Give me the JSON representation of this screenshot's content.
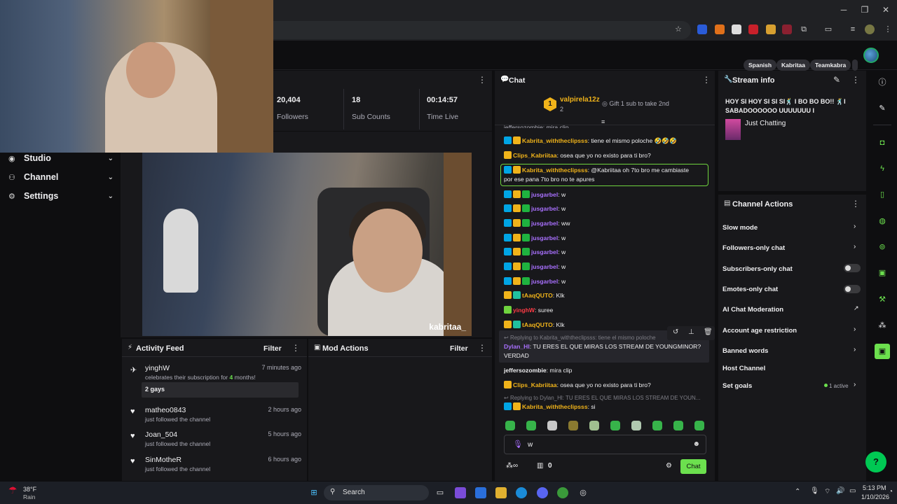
{
  "browser": {
    "win_minimize": "─",
    "win_maximize": "❐",
    "win_close": "✕",
    "icons": [
      "star-icon",
      "extension-icon",
      "extension-icon",
      "extension-icon",
      "extension-icon",
      "extension-icon",
      "extension-icon",
      "puzzle-icon",
      "sidebar-icon",
      "media-icon",
      "profile-icon",
      "menu-icon"
    ]
  },
  "sidebar": {
    "items": [
      {
        "label": "Studio",
        "icon": "studio-icon"
      },
      {
        "label": "Channel",
        "icon": "channel-icon"
      },
      {
        "label": "Settings",
        "icon": "gear-icon"
      }
    ]
  },
  "stats": [
    {
      "value": "20,404",
      "label": "Followers"
    },
    {
      "value": "18",
      "label": "Sub Counts"
    },
    {
      "value": "00:14:57",
      "label": "Time Live"
    }
  ],
  "video": {
    "watermark": "kabritaa_"
  },
  "activity_feed": {
    "title": "Activity Feed",
    "filter": "Filter",
    "items": [
      {
        "name": "yinghW",
        "desc_pre": "celebrates their subscription for ",
        "desc_num": "4",
        "desc_post": " months!",
        "time": "7 minutes ago",
        "message": "2 gays"
      },
      {
        "name": "matheo0843",
        "desc": "just followed the channel",
        "time": "2 hours ago"
      },
      {
        "name": "Joan_504",
        "desc": "just followed the channel",
        "time": "5 hours ago"
      },
      {
        "name": "SinMotheR",
        "desc": "just followed the channel",
        "time": "6 hours ago"
      }
    ]
  },
  "mod_actions": {
    "title": "Mod Actions",
    "filter": "Filter"
  },
  "chat": {
    "title": "Chat",
    "hype": {
      "rank": "1",
      "user": "valpirela12z",
      "count": "2",
      "gift": "Gift 1 sub to take 2nd"
    },
    "top_cut": "jeffersozombie: mira clip",
    "messages": [
      {
        "user": "Kabrita_withtheclipsss",
        "text": ": tiene el mismo poloche 🤣🤣🤣"
      },
      {
        "user": "Clips_Kabriitaa",
        "text": ": osea que yo no existo para ti bro?"
      },
      {
        "user": "Kabrita_withtheclipsss",
        "text": ": @Kabriitaa oh 7to bro me cambiaste",
        "text2": "por ese pana 7to bro no te apures"
      },
      {
        "user": "jusgarbel",
        "text": ": w"
      },
      {
        "user": "jusgarbel",
        "text": ": w"
      },
      {
        "user": "jusgarbel",
        "text": ": ww"
      },
      {
        "user": "jusgarbel",
        "text": ": w"
      },
      {
        "user": "jusgarbel",
        "text": ": w"
      },
      {
        "user": "jusgarbel",
        "text": ": w"
      },
      {
        "user": "jusgarbel",
        "text": ": w"
      },
      {
        "user": "tAaqQUTO",
        "text": ": Klk"
      },
      {
        "user": "yinghW",
        "text": ": suree"
      },
      {
        "user": "tAaqQUTO",
        "text": ": Klk"
      },
      {
        "reply": "Replying to Kabrita_withtheclipsss: tiene el mismo poloche",
        "user": "Dylan_Hl",
        "text": ": TU ERES EL QUE MIRAS LOS STREAM DE YOUNGMINOR?",
        "text2": "VERDAD"
      },
      {
        "user": "jeffersozombie",
        "text": ": mira clip"
      },
      {
        "user": "Clips_Kabriitaa",
        "text": ": osea que yo no existo para ti bro?"
      },
      {
        "reply": "Replying to Dylan_Hl: TU ERES EL QUE MIRAS LOS STREAM DE YOUN...",
        "user": "Kabrita_withtheclipsss",
        "text": ": si"
      }
    ],
    "input_value": "w",
    "points": "0",
    "send": "Chat"
  },
  "stream_info": {
    "title_label": "Stream info",
    "title": "HOY SI HOY SI SI SI🕺 I BO BO BO!! 🕺I SABADOOOOOO UUUUUUU I",
    "category": "Just Chatting",
    "tags": [
      "Spanish",
      "Kabritaa",
      "Teamkabra"
    ]
  },
  "channel_actions": {
    "title": "Channel Actions",
    "items": [
      {
        "label": "Slow mode",
        "kind": "chevron"
      },
      {
        "label": "Followers-only chat",
        "kind": "chevron"
      },
      {
        "label": "Subscribers-only chat",
        "kind": "toggle"
      },
      {
        "label": "Emotes-only chat",
        "kind": "toggle"
      },
      {
        "label": "AI Chat Moderation",
        "kind": "external"
      },
      {
        "label": "Account age restriction",
        "kind": "chevron"
      },
      {
        "label": "Banned words",
        "kind": "chevron"
      },
      {
        "label": "Host Channel",
        "kind": "none"
      },
      {
        "label": "Set goals",
        "kind": "chevron",
        "status": "1 active"
      }
    ]
  },
  "taskbar": {
    "weather_temp": "38°F",
    "weather_desc": "Rain",
    "search": "Search",
    "time": "5:13 PM",
    "date": "1/10/2026"
  },
  "colors": {
    "accent": "#6ce04e",
    "gold": "#f0b31a",
    "purple": "#a970ff",
    "panel": "#18181b",
    "bg": "#0e0e10"
  }
}
